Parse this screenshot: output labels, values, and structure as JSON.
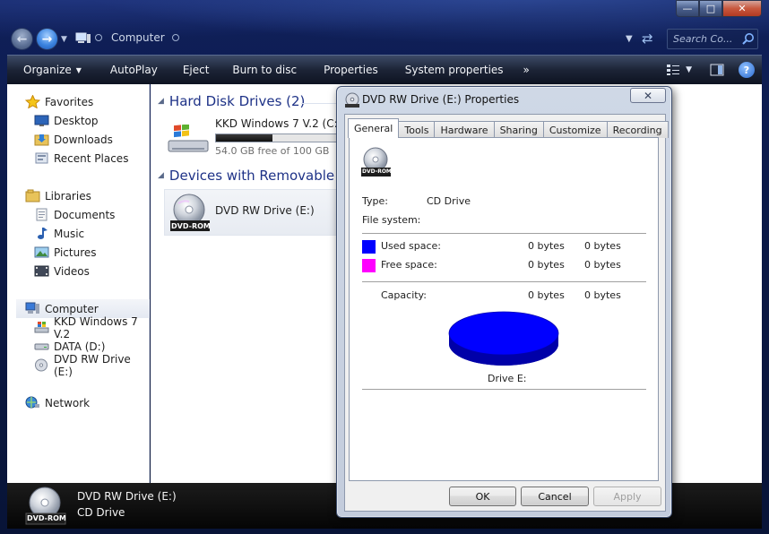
{
  "window": {
    "address": "Computer",
    "search_placeholder": "Search Co...",
    "caption": {
      "minimize": "—",
      "maximize": "□",
      "close": "✕"
    }
  },
  "toolbar": {
    "organize": "Organize",
    "autoplay": "AutoPlay",
    "eject": "Eject",
    "burn": "Burn to disc",
    "properties": "Properties",
    "system_properties": "System properties",
    "more": "»"
  },
  "sidebar": {
    "favorites": "Favorites",
    "desktop": "Desktop",
    "downloads": "Downloads",
    "recent_places": "Recent Places",
    "libraries": "Libraries",
    "documents": "Documents",
    "music": "Music",
    "pictures": "Pictures",
    "videos": "Videos",
    "computer": "Computer",
    "drive_c": "KKD Windows 7 V.2",
    "drive_d": "DATA (D:)",
    "drive_e": "DVD RW Drive (E:)",
    "network": "Network"
  },
  "content": {
    "hdd_header": "Hard Disk Drives (2)",
    "drive_c_name": "KKD Windows 7 V.2  (C:)",
    "drive_c_free": "54.0 GB free of 100 GB",
    "drive_c_used_fraction": 0.46,
    "removable_header": "Devices with Removable Sto",
    "dvd_name": "DVD RW Drive (E:)",
    "dvd_badge": "DVD-ROM"
  },
  "details": {
    "name": "DVD RW Drive (E:)",
    "type": "CD Drive",
    "badge": "DVD-ROM"
  },
  "dialog": {
    "title": "DVD RW Drive (E:) Properties",
    "close": "✕",
    "tabs": [
      "General",
      "Tools",
      "Hardware",
      "Sharing",
      "Customize",
      "Recording"
    ],
    "icon_badge": "DVD-ROM",
    "type_label": "Type:",
    "type_value": "CD Drive",
    "fs_label": "File system:",
    "used_label": "Used space:",
    "used_bytes": "0 bytes",
    "used_size": "0 bytes",
    "free_label": "Free space:",
    "free_bytes": "0 bytes",
    "free_size": "0 bytes",
    "cap_label": "Capacity:",
    "cap_bytes": "0 bytes",
    "cap_size": "0 bytes",
    "drive_label": "Drive E:",
    "ok": "OK",
    "cancel": "Cancel",
    "apply": "Apply",
    "used_color": "#0000ff",
    "free_color": "#ff00ff"
  }
}
